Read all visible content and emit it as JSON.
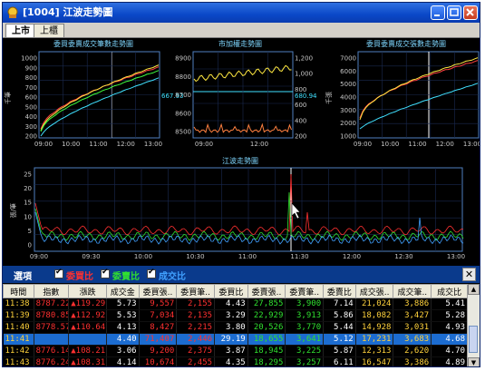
{
  "window": {
    "title": "[1004] 江波走勢圖"
  },
  "tabs": [
    {
      "label": "上市"
    },
    {
      "label": "上櫃"
    }
  ],
  "charts": {
    "left": {
      "title": "委買委賣成交筆數走勢圖",
      "ylabel": "千筆",
      "yticks": [
        "1000",
        "900",
        "800",
        "700",
        "600",
        "500",
        "400",
        "300",
        "200"
      ],
      "xticks": [
        "09:00",
        "10:00",
        "11:00",
        "12:00",
        "13:00"
      ],
      "colors": [
        "#ff4040",
        "#ffe840",
        "#40ff40",
        "#40e0ff"
      ]
    },
    "middle": {
      "title": "市加權走勢圖",
      "left_ticks": [
        "8900",
        "8800",
        "8700",
        "8600",
        "8500"
      ],
      "right_ticks": [
        "1,200",
        "1,000",
        "800",
        "600",
        "400",
        "200"
      ],
      "ref_left": "667.93",
      "ref_right": "680.94",
      "xticks": [
        "09:00",
        "12:00"
      ],
      "colors": [
        "#ffe840",
        "#40e0ff",
        "#ff8040"
      ]
    },
    "right": {
      "title": "委買委賣成交張數走勢圖",
      "ylabel": "千張",
      "yticks": [
        "7000",
        "6000",
        "5000",
        "4000",
        "3000",
        "2000",
        "1000"
      ],
      "xticks": [
        "09:00",
        "10:00",
        "11:00",
        "12:00",
        "13:00"
      ],
      "colors": [
        "#ff4040",
        "#ffe840",
        "#40e0ff"
      ]
    },
    "bottom": {
      "title": "江波走勢圖",
      "ylabel": "張/筆",
      "yticks": [
        "25",
        "20",
        "15",
        "10",
        "5",
        "0"
      ],
      "xticks": [
        "09:00",
        "09:30",
        "10:00",
        "10:30",
        "11:00",
        "11:30",
        "12:00",
        "12:30",
        "13:00"
      ],
      "colors": [
        "#ff3030",
        "#30e030",
        "#40a0ff"
      ]
    }
  },
  "options": {
    "label": "選項",
    "checks": [
      {
        "label": "委買比",
        "color": "#ff3030"
      },
      {
        "label": "委賣比",
        "color": "#30e030"
      },
      {
        "label": "成交比",
        "color": "#40a0ff"
      }
    ]
  },
  "table": {
    "headers": [
      "時間",
      "指數",
      "漲跌",
      "成交金",
      "委買張..",
      "委買筆..",
      "委買比",
      "委賣張..",
      "委賣筆..",
      "委賣比",
      "成交張..",
      "成交筆..",
      "成交比"
    ],
    "rows": [
      [
        "11:38",
        "8787.22",
        "▲119.29",
        "5.73",
        "9,557",
        "2,155",
        "4.43",
        "27,855",
        "3,900",
        "7.14",
        "21,024",
        "3,886",
        "5.41"
      ],
      [
        "11:39",
        "8780.85",
        "▲112.92",
        "5.53",
        "7,034",
        "2,135",
        "3.29",
        "22,929",
        "3,913",
        "5.86",
        "18,082",
        "3,427",
        "5.28"
      ],
      [
        "11:40",
        "8778.57",
        "▲110.64",
        "4.13",
        "8,427",
        "2,215",
        "3.80",
        "20,526",
        "3,770",
        "5.44",
        "14,928",
        "3,031",
        "4.93"
      ],
      [
        "11:41",
        "",
        "",
        "4.40",
        "71,407",
        "2,446",
        "29.19",
        "18,655",
        "3,641",
        "5.12",
        "17,231",
        "3,683",
        "4.68"
      ],
      [
        "11:42",
        "8776.14",
        "▲108.21",
        "3.06",
        "9,200",
        "2,375",
        "3.87",
        "18,945",
        "3,225",
        "5.87",
        "12,313",
        "2,620",
        "4.70"
      ],
      [
        "11:43",
        "8776.24",
        "▲108.31",
        "4.14",
        "10,674",
        "2,455",
        "4.35",
        "18,295",
        "3,257",
        "6.11",
        "16,547",
        "3,386",
        "4.89"
      ]
    ],
    "selected_row": 3
  }
}
